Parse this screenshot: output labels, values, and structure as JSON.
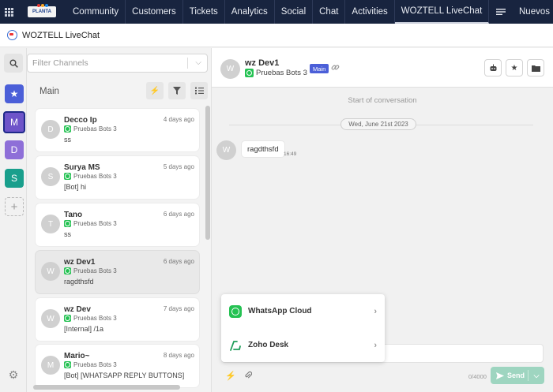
{
  "topnav": {
    "logo": "PLANTA",
    "items": [
      {
        "label": "Community"
      },
      {
        "label": "Customers"
      },
      {
        "label": "Tickets"
      },
      {
        "label": "Analytics"
      },
      {
        "label": "Social"
      },
      {
        "label": "Chat"
      },
      {
        "label": "Activities"
      },
      {
        "label": "WOZTELL LiveChat"
      }
    ],
    "right_label": "Nuevos"
  },
  "app": {
    "title": "WOZTELL LiveChat"
  },
  "rail": {
    "items": [
      {
        "icon": "star-icon"
      },
      {
        "letter": "M"
      },
      {
        "letter": "D"
      },
      {
        "letter": "S"
      }
    ],
    "add": "+"
  },
  "filter": {
    "placeholder": "Filter Channels"
  },
  "list": {
    "title": "Main",
    "conversations": [
      {
        "avatar": "D",
        "name": "Decco Ip",
        "time": "4 days ago",
        "channel": "Pruebas Bots 3",
        "message": "ss"
      },
      {
        "avatar": "S",
        "name": "Surya MS",
        "time": "5 days ago",
        "channel": "Pruebas Bots 3",
        "message": "[Bot] hi"
      },
      {
        "avatar": "T",
        "name": "Tano",
        "time": "6 days ago",
        "channel": "Pruebas Bots 3",
        "message": "ss"
      },
      {
        "avatar": "W",
        "name": "wz Dev1",
        "time": "6 days ago",
        "channel": "Pruebas Bots 3",
        "message": "ragdthsfd"
      },
      {
        "avatar": "W",
        "name": "wz Dev",
        "time": "7 days ago",
        "channel": "Pruebas Bots 3",
        "message": "[Internal] /1a"
      },
      {
        "avatar": "M",
        "name": "Mario~",
        "time": "8 days ago",
        "channel": "Pruebas Bots 3",
        "message": "[Bot] [WHATSAPP REPLY BUTTONS]"
      }
    ]
  },
  "chat": {
    "avatar": "W",
    "name": "wz Dev1",
    "channel": "Pruebas Bots 3",
    "badge": "Main",
    "start_text": "Start of conversation",
    "date": "Wed, June 21st 2023",
    "message": {
      "avatar": "W",
      "text": "ragdthsfd",
      "time": "16:49"
    },
    "popup": [
      {
        "label": "WhatsApp Cloud"
      },
      {
        "label": "Zoho Desk"
      }
    ],
    "counter": "0/4000",
    "send_label": "Send"
  }
}
